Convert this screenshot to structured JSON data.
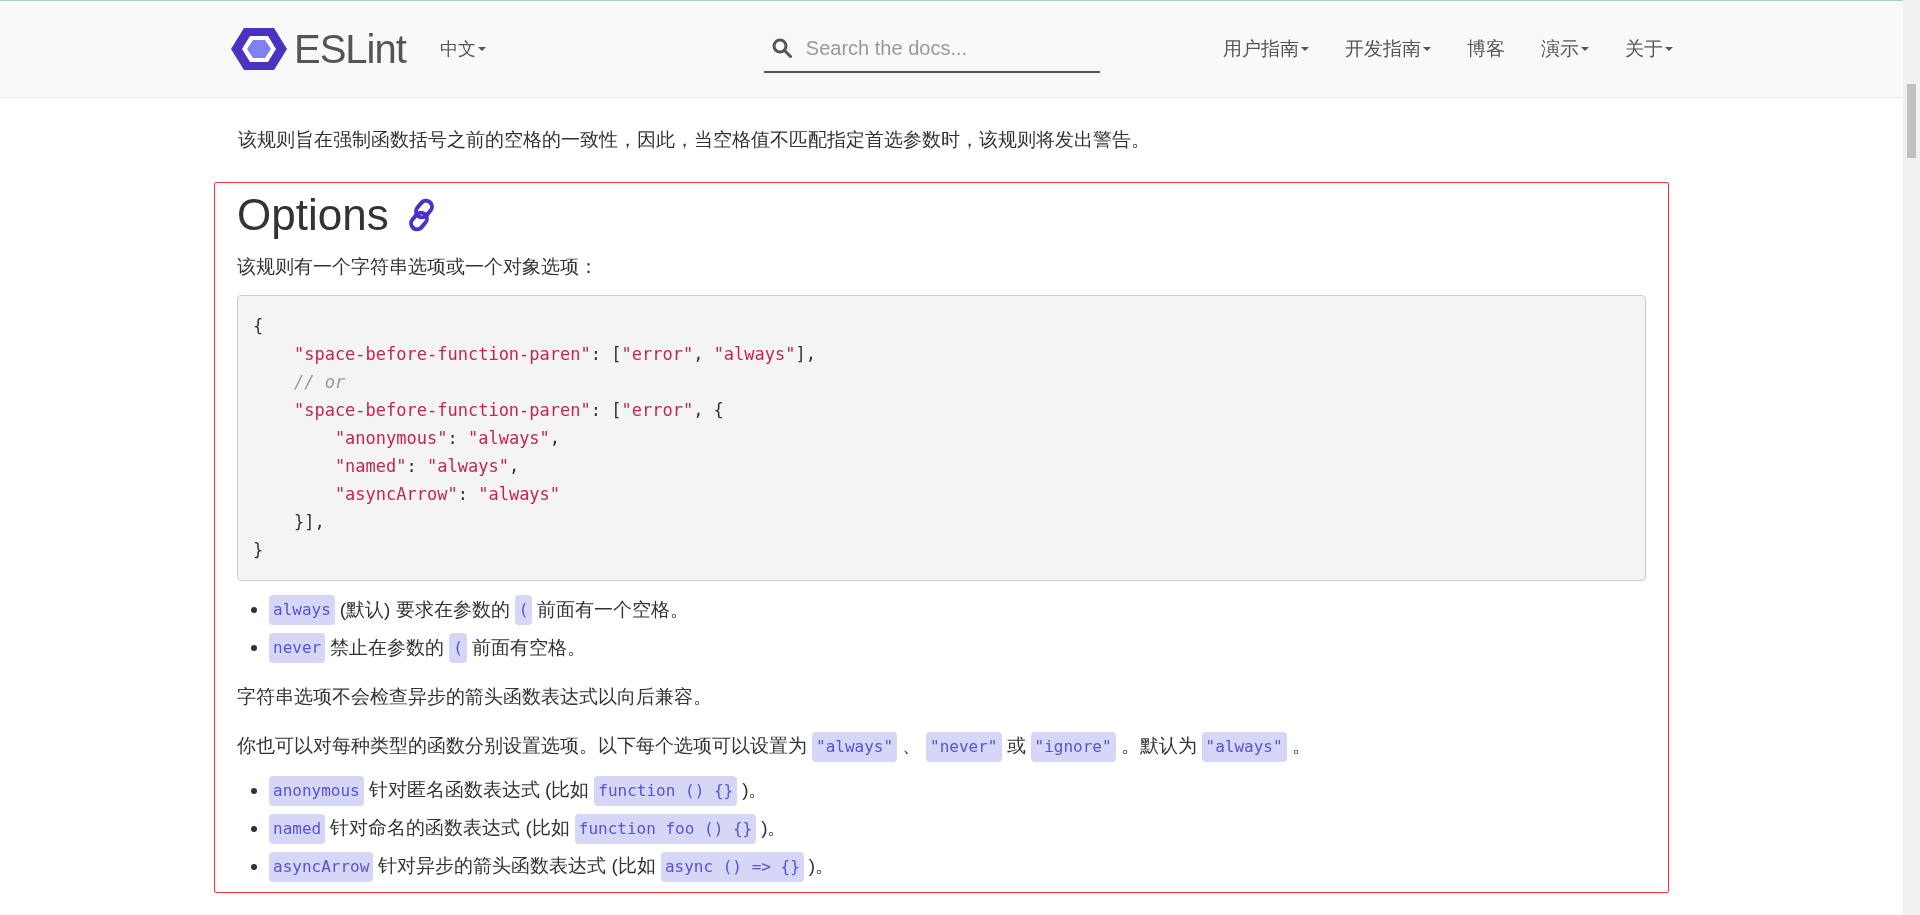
{
  "header": {
    "logo": "ESLint",
    "language": "中文",
    "search": {
      "placeholder": "Search the docs..."
    },
    "nav": [
      {
        "label": "用户指南",
        "caret": true
      },
      {
        "label": "开发指南",
        "caret": true
      },
      {
        "label": "博客",
        "caret": false
      },
      {
        "label": "演示",
        "caret": true
      },
      {
        "label": "关于",
        "caret": true
      }
    ]
  },
  "intro": "该规则旨在强制函数括号之前的空格的一致性，因此，当空格值不匹配指定首选参数时，该规则将发出警告。",
  "section": {
    "title": "Options",
    "lead": "该规则有一个字符串选项或一个对象选项：",
    "code": [
      [
        {
          "kind": "punct",
          "text": "{"
        }
      ],
      [
        {
          "kind": "string",
          "text": "    \"space-before-function-paren\""
        },
        {
          "kind": "punct",
          "text": ": ["
        },
        {
          "kind": "string",
          "text": "\"error\""
        },
        {
          "kind": "punct",
          "text": ", "
        },
        {
          "kind": "string",
          "text": "\"always\""
        },
        {
          "kind": "punct",
          "text": "],"
        }
      ],
      [
        {
          "kind": "comment",
          "text": "    // or"
        }
      ],
      [
        {
          "kind": "string",
          "text": "    \"space-before-function-paren\""
        },
        {
          "kind": "punct",
          "text": ": ["
        },
        {
          "kind": "string",
          "text": "\"error\""
        },
        {
          "kind": "punct",
          "text": ", {"
        }
      ],
      [
        {
          "kind": "string",
          "text": "        \"anonymous\""
        },
        {
          "kind": "punct",
          "text": ": "
        },
        {
          "kind": "string",
          "text": "\"always\""
        },
        {
          "kind": "punct",
          "text": ","
        }
      ],
      [
        {
          "kind": "string",
          "text": "        \"named\""
        },
        {
          "kind": "punct",
          "text": ": "
        },
        {
          "kind": "string",
          "text": "\"always\""
        },
        {
          "kind": "punct",
          "text": ","
        }
      ],
      [
        {
          "kind": "string",
          "text": "        \"asyncArrow\""
        },
        {
          "kind": "punct",
          "text": ": "
        },
        {
          "kind": "string",
          "text": "\"always\""
        }
      ],
      [
        {
          "kind": "punct",
          "text": "    }],"
        }
      ],
      [
        {
          "kind": "punct",
          "text": "}"
        }
      ]
    ],
    "blocks": [
      {
        "kind": "list",
        "items": [
          [
            {
              "kind": "code",
              "text": "always"
            },
            {
              "kind": "text",
              "text": "(默认) 要求在参数的"
            },
            {
              "kind": "code",
              "text": "("
            },
            {
              "kind": "text",
              "text": "前面有一个空格。"
            }
          ],
          [
            {
              "kind": "code",
              "text": "never"
            },
            {
              "kind": "text",
              "text": "禁止在参数的"
            },
            {
              "kind": "code",
              "text": "("
            },
            {
              "kind": "text",
              "text": "前面有空格。"
            }
          ]
        ]
      },
      {
        "kind": "paragraph",
        "parts": [
          {
            "kind": "text",
            "text": "字符串选项不会检查异步的箭头函数表达式以向后兼容。"
          }
        ]
      },
      {
        "kind": "paragraph",
        "parts": [
          {
            "kind": "text",
            "text": "你也可以对每种类型的函数分别设置选项。以下每个选项可以设置为"
          },
          {
            "kind": "code",
            "text": "\"always\""
          },
          {
            "kind": "text",
            "text": "、"
          },
          {
            "kind": "code",
            "text": "\"never\""
          },
          {
            "kind": "text",
            "text": "或"
          },
          {
            "kind": "code",
            "text": "\"ignore\""
          },
          {
            "kind": "text",
            "text": "。默认为"
          },
          {
            "kind": "code",
            "text": "\"always\""
          },
          {
            "kind": "text",
            "text": "。"
          }
        ]
      },
      {
        "kind": "list",
        "items": [
          [
            {
              "kind": "code",
              "text": "anonymous"
            },
            {
              "kind": "text",
              "text": "针对匿名函数表达式 (比如"
            },
            {
              "kind": "code",
              "text": "function () {}"
            },
            {
              "kind": "text",
              "text": ")。"
            }
          ],
          [
            {
              "kind": "code",
              "text": "named"
            },
            {
              "kind": "text",
              "text": "针对命名的函数表达式 (比如"
            },
            {
              "kind": "code",
              "text": "function foo () {}"
            },
            {
              "kind": "text",
              "text": ")。"
            }
          ],
          [
            {
              "kind": "code",
              "text": "asyncArrow"
            },
            {
              "kind": "text",
              "text": "针对异步的箭头函数表达式 (比如"
            },
            {
              "kind": "code",
              "text": "async () => {}"
            },
            {
              "kind": "text",
              "text": ")。"
            }
          ]
        ]
      }
    ]
  }
}
